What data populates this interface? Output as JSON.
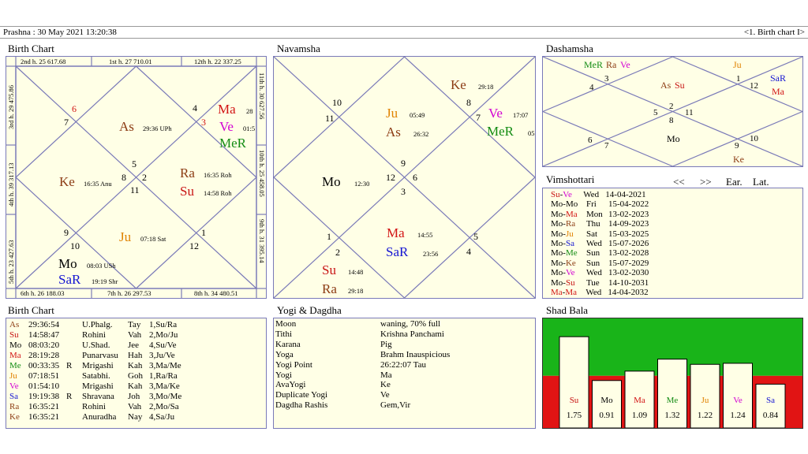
{
  "header": {
    "left": "Prashna :   30 May 2021  13:20:38",
    "right": "<1. Birth chart I>"
  },
  "titles": {
    "birth_chart": "Birth Chart",
    "navamsha": "Navamsha",
    "dashamsha": "Dashamsha",
    "vimshottari": "Vimshottari",
    "birth_chart_2": "Birth Chart",
    "yogi": "Yogi & Dagdha",
    "shad_bala": "Shad Bala"
  },
  "vim_nav": {
    "prev": "<<",
    "next": ">>",
    "ear": "Ear.",
    "lat": "Lat."
  },
  "birth_chart": {
    "edge_top": [
      "2nd h.  25  617.68",
      "1st h.  27  710.01",
      "12th h.  22  337.25"
    ],
    "edge_bottom": [
      "6th h.  26  188.03",
      "7th h.  26  297.53",
      "8th h.  34  480.51"
    ],
    "edge_left": [
      "3rd h.  29  475.86",
      "4th h.  39  317.13",
      "5th h.  23  427.63"
    ],
    "edge_right": [
      "11th h.  30  627.56",
      "10th h.  25  458.05",
      "9th h.  31  395.14"
    ],
    "house_numbers": [
      "6",
      "7",
      "5",
      "8",
      "2",
      "11",
      "4",
      "3",
      "9",
      "10",
      "1",
      "12"
    ],
    "planets": [
      {
        "name": "Ma",
        "detail": "28",
        "color": "#d21414"
      },
      {
        "name": "Ve",
        "detail": "01:5",
        "color": "#d200d2"
      },
      {
        "name": "MeR",
        "detail": "",
        "color": "#148c14"
      },
      {
        "name": "As",
        "detail": "29:36  UPh",
        "color": "#8c3c14"
      },
      {
        "name": "Ke",
        "detail": "16:35  Anu",
        "color": "#8c3c14"
      },
      {
        "name": "Ra",
        "detail": "16:35  Roh",
        "color": "#8c3c14"
      },
      {
        "name": "Su",
        "detail": "14:58  Roh",
        "color": "#c81414"
      },
      {
        "name": "Ju",
        "detail": "07:18  Sat",
        "color": "#e08200"
      },
      {
        "name": "Mo",
        "detail": "08:03  USh",
        "color": "#000000"
      },
      {
        "name": "SaR",
        "detail": "19:19  Shr",
        "color": "#1414d2"
      }
    ]
  },
  "navamsha": {
    "house_numbers": [
      "10",
      "11",
      "8",
      "7",
      "9",
      "12",
      "6",
      "3",
      "1",
      "2",
      "5",
      "4"
    ],
    "planets": [
      {
        "name": "Ke",
        "detail": "29:18",
        "color": "#8c3c14"
      },
      {
        "name": "Ju",
        "detail": "05:49",
        "color": "#e08200"
      },
      {
        "name": "As",
        "detail": "26:32",
        "color": "#8c3c14"
      },
      {
        "name": "Ve",
        "detail": "17:07",
        "color": "#d200d2"
      },
      {
        "name": "MeR",
        "detail": "05",
        "color": "#148c14"
      },
      {
        "name": "Mo",
        "detail": "12:30",
        "color": "#000000"
      },
      {
        "name": "Ma",
        "detail": "14:55",
        "color": "#d21414"
      },
      {
        "name": "SaR",
        "detail": "23:56",
        "color": "#1414d2"
      },
      {
        "name": "Su",
        "detail": "14:48",
        "color": "#c81414"
      },
      {
        "name": "Ra",
        "detail": "29:18",
        "color": "#8c3c14"
      }
    ]
  },
  "dashamsha": {
    "house_numbers": [
      "4",
      "3",
      "1",
      "12",
      "5",
      "2",
      "11",
      "8",
      "6",
      "7",
      "9",
      "10"
    ],
    "planets": [
      {
        "name": "MeR",
        "color": "#148c14"
      },
      {
        "name": "Ra",
        "color": "#8c3c14"
      },
      {
        "name": "Ve",
        "color": "#d200d2"
      },
      {
        "name": "Ju",
        "color": "#e08200"
      },
      {
        "name": "As",
        "color": "#8c3c14"
      },
      {
        "name": "Su",
        "color": "#c81414"
      },
      {
        "name": "SaR",
        "color": "#1414d2"
      },
      {
        "name": "Ma",
        "color": "#d21414"
      },
      {
        "name": "Mo",
        "color": "#000000"
      },
      {
        "name": "Ke",
        "color": "#8c3c14"
      }
    ]
  },
  "vimshottari": [
    {
      "p1": "Su",
      "c1": "#c81414",
      "p2": "Ve",
      "c2": "#d200d2",
      "day": "Wed",
      "date": "14-04-2021"
    },
    {
      "p1": "Mo",
      "c1": "#000000",
      "p2": "Mo",
      "c2": "#000000",
      "day": "Fri",
      "date": "15-04-2022"
    },
    {
      "p1": "Mo",
      "c1": "#000000",
      "p2": "Ma",
      "c2": "#d21414",
      "day": "Mon",
      "date": "13-02-2023"
    },
    {
      "p1": "Mo",
      "c1": "#000000",
      "p2": "Ra",
      "c2": "#8c3c14",
      "day": "Thu",
      "date": "14-09-2023"
    },
    {
      "p1": "Mo",
      "c1": "#000000",
      "p2": "Ju",
      "c2": "#e08200",
      "day": "Sat",
      "date": "15-03-2025"
    },
    {
      "p1": "Mo",
      "c1": "#000000",
      "p2": "Sa",
      "c2": "#1414d2",
      "day": "Wed",
      "date": "15-07-2026"
    },
    {
      "p1": "Mo",
      "c1": "#000000",
      "p2": "Me",
      "c2": "#148c14",
      "day": "Sun",
      "date": "13-02-2028"
    },
    {
      "p1": "Mo",
      "c1": "#000000",
      "p2": "Ke",
      "c2": "#8c3c14",
      "day": "Sun",
      "date": "15-07-2029"
    },
    {
      "p1": "Mo",
      "c1": "#000000",
      "p2": "Ve",
      "c2": "#d200d2",
      "day": "Wed",
      "date": "13-02-2030"
    },
    {
      "p1": "Mo",
      "c1": "#000000",
      "p2": "Su",
      "c2": "#c81414",
      "day": "Tue",
      "date": "14-10-2031"
    },
    {
      "p1": "Ma",
      "c1": "#d21414",
      "p2": "Ma",
      "c2": "#d21414",
      "day": "Wed",
      "date": "14-04-2032"
    }
  ],
  "birth_table": [
    {
      "p": "As",
      "color": "#8c3c14",
      "deg": "29:36:54",
      "r": "",
      "nak": "U.Phalg.",
      "a": "Tay",
      "b": "1,Su/Ra"
    },
    {
      "p": "Su",
      "color": "#c81414",
      "deg": "14:58:47",
      "r": "",
      "nak": "Rohini",
      "a": "Vah",
      "b": "2,Mo/Ju"
    },
    {
      "p": "Mo",
      "color": "#000000",
      "deg": "08:03:20",
      "r": "",
      "nak": "U.Shad.",
      "a": "Jee",
      "b": "4,Su/Ve"
    },
    {
      "p": "Ma",
      "color": "#d21414",
      "deg": "28:19:28",
      "r": "",
      "nak": "Punarvasu",
      "a": "Hah",
      "b": "3,Ju/Ve"
    },
    {
      "p": "Me",
      "color": "#148c14",
      "deg": "00:33:35",
      "r": "R",
      "nak": "Mrigashi",
      "a": "Kah",
      "b": "3,Ma/Me"
    },
    {
      "p": "Ju",
      "color": "#e08200",
      "deg": "07:18:51",
      "r": "",
      "nak": "Satabhi.",
      "a": "Goh",
      "b": "1,Ra/Ra"
    },
    {
      "p": "Ve",
      "color": "#d200d2",
      "deg": "01:54:10",
      "r": "",
      "nak": "Mrigashi",
      "a": "Kah",
      "b": "3,Ma/Ke"
    },
    {
      "p": "Sa",
      "color": "#1414d2",
      "deg": "19:19:38",
      "r": "R",
      "nak": "Shravana",
      "a": "Joh",
      "b": "3,Mo/Me"
    },
    {
      "p": "Ra",
      "color": "#8c3c14",
      "deg": "16:35:21",
      "r": "",
      "nak": "Rohini",
      "a": "Vah",
      "b": "2,Mo/Sa"
    },
    {
      "p": "Ke",
      "color": "#8c3c14",
      "deg": "16:35:21",
      "r": "",
      "nak": "Anuradha",
      "a": "Nay",
      "b": "4,Sa/Ju"
    }
  ],
  "yogi_table": [
    {
      "k": "Moon",
      "v": "waning, 70% full"
    },
    {
      "k": "Tithi",
      "v": "Krishna  Panchami"
    },
    {
      "k": "Karana",
      "v": "Pig"
    },
    {
      "k": "Yoga",
      "v": "Brahm Inauspicious"
    },
    {
      "k": "Yogi Point",
      "v": "26:22:07 Tau"
    },
    {
      "k": "Yogi",
      "v": "Ma"
    },
    {
      "k": "AvaYogi",
      "v": "Ke"
    },
    {
      "k": "Duplicate Yogi",
      "v": "Ve"
    },
    {
      "k": "Dagdha Rashis",
      "v": "Gem,Vir"
    }
  ],
  "chart_data": {
    "type": "bar",
    "categories": [
      "Su",
      "Mo",
      "Ma",
      "Me",
      "Ju",
      "Ve",
      "Sa"
    ],
    "values": [
      1.75,
      0.91,
      1.09,
      1.32,
      1.22,
      1.24,
      0.84
    ],
    "value_labels": [
      "1.75",
      "0.91",
      "1.09",
      "1.32",
      "1.22",
      "1.24",
      "0.84"
    ],
    "colors": [
      "#c81414",
      "#000000",
      "#d21414",
      "#148c14",
      "#e08200",
      "#d200d2",
      "#1414d2"
    ],
    "threshold": 1.0,
    "ylim": [
      0,
      2.1
    ],
    "background_colors": {
      "above": "#19b419",
      "below": "#e11414"
    },
    "title": "",
    "xlabel": "",
    "ylabel": ""
  }
}
